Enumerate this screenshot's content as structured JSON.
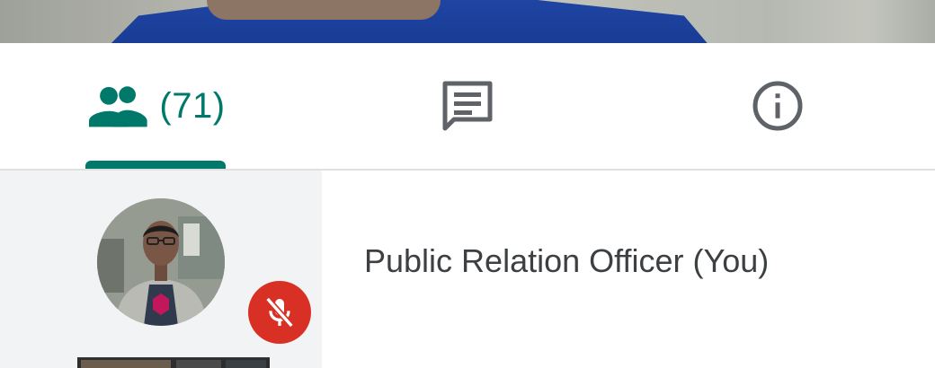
{
  "tabs": {
    "people": {
      "icon": "people-icon",
      "count_label": "(71)",
      "selected": true
    },
    "chat": {
      "icon": "chat-icon"
    },
    "info": {
      "icon": "info-icon"
    }
  },
  "participants": [
    {
      "name": "Public Relation Officer (You)",
      "mic": "muted",
      "mic_icon": "mic-off-icon"
    }
  ],
  "colors": {
    "accent": "#00796b",
    "muted_badge": "#d93025",
    "icon_gray": "#5f6368",
    "text": "#3c4043",
    "thumb_bg": "#f1f3f4"
  }
}
